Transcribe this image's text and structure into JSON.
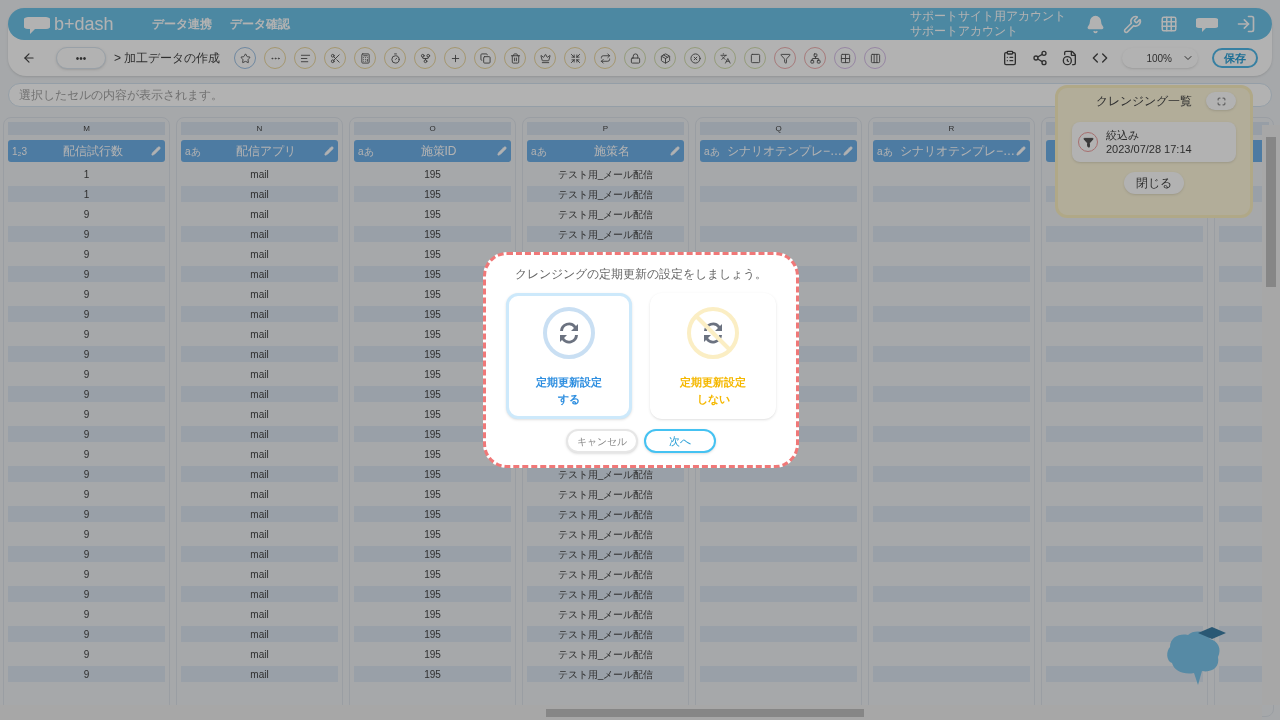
{
  "header": {
    "logo": "b+dash",
    "nav": [
      "データ連携",
      "データ確認"
    ],
    "account": [
      "サポートサイト用アカウント",
      "サポートアカウント"
    ]
  },
  "toolbar": {
    "breadcrumb_more": "•••",
    "breadcrumb": "> 加工データの作成",
    "tools": [
      {
        "kind": "star"
      },
      {
        "kind": "more"
      },
      {
        "kind": "lines"
      },
      {
        "kind": "scissors"
      },
      {
        "kind": "calculator"
      },
      {
        "kind": "timer"
      },
      {
        "kind": "fork"
      },
      {
        "kind": "plus"
      },
      {
        "kind": "copy"
      },
      {
        "kind": "trash"
      },
      {
        "kind": "crown"
      },
      {
        "kind": "shrink"
      },
      {
        "kind": "repeat"
      },
      {
        "kind": "lock"
      },
      {
        "kind": "box"
      },
      {
        "kind": "xcircle"
      },
      {
        "kind": "translate"
      },
      {
        "kind": "square"
      },
      {
        "kind": "filter"
      },
      {
        "kind": "network"
      },
      {
        "kind": "grid"
      },
      {
        "kind": "columns"
      }
    ],
    "zoom": "100%",
    "save": "保存"
  },
  "cell_preview": {
    "placeholder": "選択したセルの内容が表示されます。"
  },
  "columns": [
    {
      "letter": "M",
      "type": "1₂3",
      "name": "配信試行数"
    },
    {
      "letter": "N",
      "type": "aあ",
      "name": "配信アプリ"
    },
    {
      "letter": "O",
      "type": "aあ",
      "name": "施策ID"
    },
    {
      "letter": "P",
      "type": "aあ",
      "name": "施策名"
    },
    {
      "letter": "Q",
      "type": "aあ",
      "name": "シナリオテンプレ−…"
    },
    {
      "letter": "R",
      "type": "aあ",
      "name": "シナリオテンプレ−…"
    }
  ],
  "rows": [
    [
      "1",
      "mail",
      "195",
      "テスト用_メール配信"
    ],
    [
      "1",
      "mail",
      "195",
      "テスト用_メール配信"
    ],
    [
      "9",
      "mail",
      "195",
      "テスト用_メール配信"
    ],
    [
      "9",
      "mail",
      "195",
      "テスト用_メール配信"
    ],
    [
      "9",
      "mail",
      "195"
    ],
    [
      "9",
      "mail",
      "195"
    ],
    [
      "9",
      "mail",
      "195"
    ],
    [
      "9",
      "mail",
      "195"
    ],
    [
      "9",
      "mail",
      "195"
    ],
    [
      "9",
      "mail",
      "195"
    ],
    [
      "9",
      "mail",
      "195"
    ],
    [
      "9",
      "mail",
      "195"
    ],
    [
      "9",
      "mail",
      "195"
    ],
    [
      "9",
      "mail",
      "195"
    ],
    [
      "9",
      "mail",
      "195"
    ],
    [
      "9",
      "mail",
      "195",
      "テスト用_メール配信"
    ],
    [
      "9",
      "mail",
      "195",
      "テスト用_メール配信"
    ],
    [
      "9",
      "mail",
      "195",
      "テスト用_メール配信"
    ],
    [
      "9",
      "mail",
      "195",
      "テスト用_メール配信"
    ],
    [
      "9",
      "mail",
      "195",
      "テスト用_メール配信"
    ],
    [
      "9",
      "mail",
      "195",
      "テスト用_メール配信"
    ],
    [
      "9",
      "mail",
      "195",
      "テスト用_メール配信"
    ],
    [
      "9",
      "mail",
      "195",
      "テスト用_メール配信"
    ],
    [
      "9",
      "mail",
      "195",
      "テスト用_メール配信"
    ],
    [
      "9",
      "mail",
      "195",
      "テスト用_メール配信"
    ],
    [
      "9",
      "mail",
      "195",
      "テスト用_メール配信"
    ]
  ],
  "cleansing_panel": {
    "title": "クレンジング一覧",
    "items": [
      {
        "name": "絞込み",
        "date": "2023/07/28 17:14"
      }
    ],
    "close": "閉じる"
  },
  "dialog": {
    "message": "クレンジングの定期更新の設定をしましょう。",
    "options": [
      {
        "kind": "enable",
        "lines": [
          "定期更新設定",
          "する"
        ],
        "color": "#2f8fe0",
        "selected": true
      },
      {
        "kind": "disable",
        "lines": [
          "定期更新設定",
          "しない"
        ],
        "color": "#f5b800",
        "selected": false
      }
    ],
    "cancel": "キャンセル",
    "next": "次へ"
  }
}
